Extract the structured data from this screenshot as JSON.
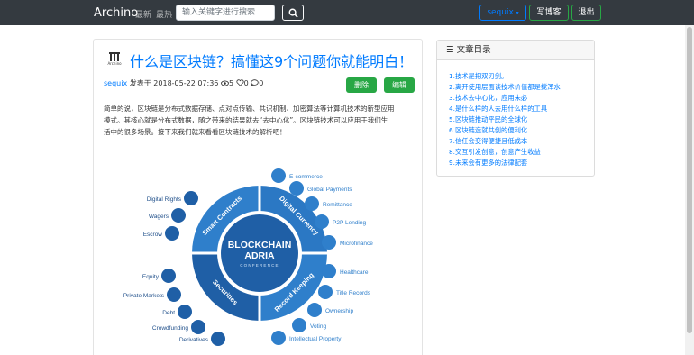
{
  "navbar": {
    "brand": "Archino",
    "links": [
      "最新",
      "最热"
    ],
    "search_placeholder": "输入关键字进行搜索",
    "user_label": "sequix",
    "write_label": "写博客",
    "logout_label": "退出"
  },
  "article": {
    "logo_text": "Archino",
    "title": "什么是区块链？搞懂这9个问题你就能明白！",
    "author": "sequix",
    "published_label": "发表于",
    "date": "2018-05-22 07:36",
    "views": "5",
    "likes": "0",
    "comments": "0",
    "delete_label": "删除",
    "edit_label": "编辑",
    "paragraph_lines": [
      "简单的说，区块链是分布式数据存储、点对点传输、共识机制、加密算法等计算机技术的新型应用",
      "模式。其核心就是分布式数据，随之带来的结果就去“去中心化”。区块链技术可以应用于我们生",
      "活中的很多场景。接下来我们就来看看区块链技术的解析吧！"
    ],
    "figure": {
      "center_title_1": "BLOCKCHAIN",
      "center_title_2": "ADRIA",
      "center_subtitle": "CONFERENCE",
      "segments": [
        "Smart Contracts",
        "Digital Currency",
        "Record Keeping",
        "Securities"
      ],
      "right_items": [
        "E-commerce",
        "Global Payments",
        "Remittance",
        "P2P Lending",
        "Microfinance",
        "Healthcare",
        "Title Records",
        "Ownership",
        "Voting",
        "Intellectual Property"
      ],
      "left_items": [
        "Digital Rights",
        "Wagers",
        "Escrow",
        "Equity",
        "Private Markets",
        "Debt",
        "Crowdfunding",
        "Derivatives"
      ]
    }
  },
  "toc": {
    "header": "文章目录",
    "items": [
      "1.技术是把双刃剑。",
      "2.离开使用层面谈技术价值都是搅浑水",
      "3.技术去中心化，应用未必",
      "4.是什么样的人去用什么样的工具",
      "5.区块链推动平民的全球化",
      "6.区块链造就共创的便利化",
      "7.信任会变得便捷且低成本",
      "8.交互引发创意，创意产生收益",
      "9.未来会有更多的法律配套"
    ]
  },
  "colors": {
    "navbar_bg": "#343a40",
    "primary": "#007bff",
    "success": "#28a745",
    "figure_dark": "#1f5fa6",
    "figure_light": "#3d8fd6"
  }
}
